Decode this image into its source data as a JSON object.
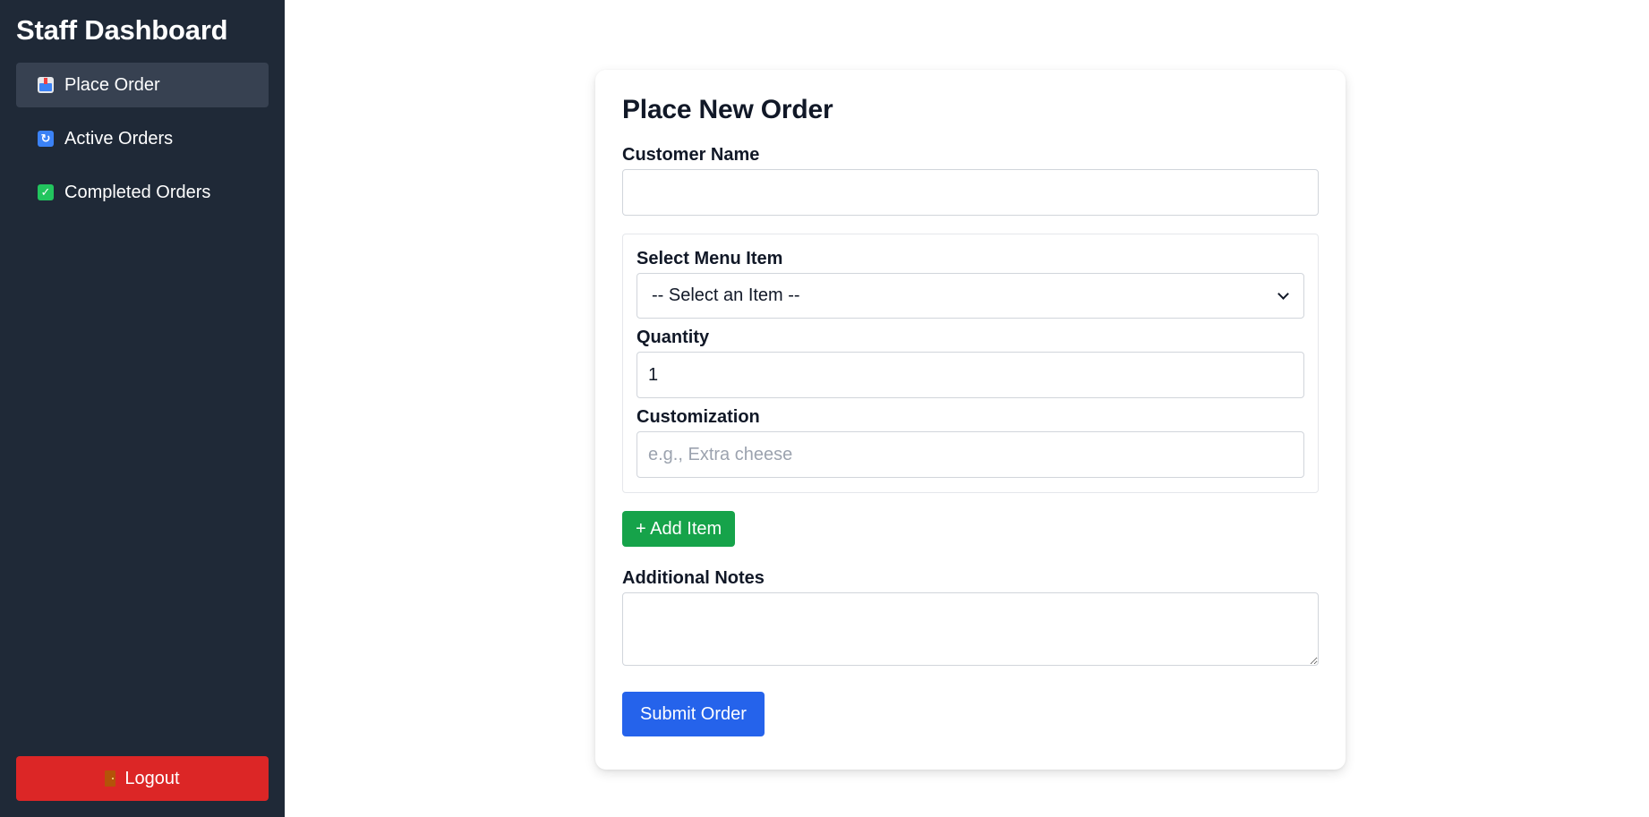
{
  "sidebar": {
    "title": "Staff Dashboard",
    "items": [
      {
        "label": "Place Order",
        "icon": "inbox-tray-icon",
        "active": true
      },
      {
        "label": "Active Orders",
        "icon": "refresh-icon",
        "active": false
      },
      {
        "label": "Completed Orders",
        "icon": "check-mark-icon",
        "active": false
      }
    ],
    "logout_label": "Logout",
    "logout_icon": "door-icon"
  },
  "form": {
    "title": "Place New Order",
    "customer_name": {
      "label": "Customer Name",
      "value": "",
      "placeholder": ""
    },
    "menu_item": {
      "label": "Select Menu Item",
      "selected": "-- Select an Item --"
    },
    "quantity": {
      "label": "Quantity",
      "value": "1"
    },
    "customization": {
      "label": "Customization",
      "value": "",
      "placeholder": "e.g., Extra cheese"
    },
    "add_item_label": "+ Add Item",
    "notes": {
      "label": "Additional Notes",
      "value": ""
    },
    "submit_label": "Submit Order"
  },
  "colors": {
    "sidebar_bg": "#1f2937",
    "active_item_bg": "#374151",
    "logout": "#dc2626",
    "add_item": "#16a34a",
    "submit": "#2563eb"
  }
}
